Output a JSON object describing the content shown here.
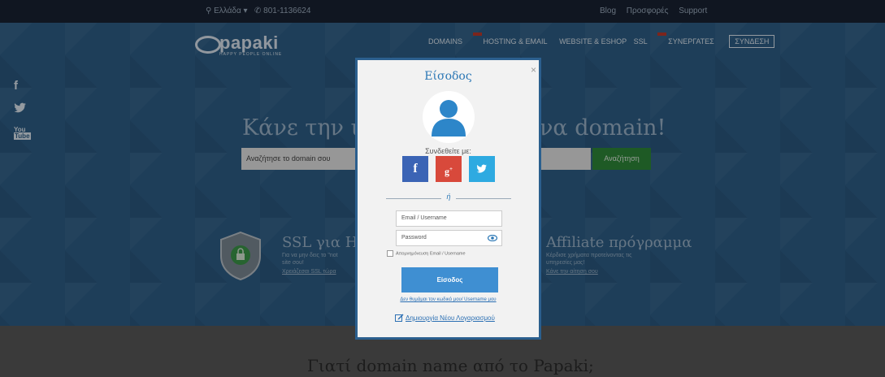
{
  "topbar": {
    "region": "Ελλάδα",
    "phone": "801-1136624",
    "links": [
      "Blog",
      "Προσφορές",
      "Support"
    ]
  },
  "logo": {
    "name": "papaki",
    "tagline": "HAPPY PEOPLE ONLINE"
  },
  "nav": {
    "items": [
      "DOMAINS",
      "HOSTING & EMAIL",
      "WEBSITE & ESHOP",
      "SSL",
      "ΣΥΝΕΡΓΑΤΕΣ"
    ],
    "login": "ΣΥΝΔΕΣΗ"
  },
  "social": [
    "facebook-icon",
    "twitter-icon",
    "youtube-icon"
  ],
  "hero": {
    "title_left": "Κάνε την ιδ",
    "title_right": "να domain!",
    "search_placeholder": "Αναζήτησε το domain σου",
    "search_button": "Αναζήτηση"
  },
  "features": {
    "ssl_title": "SSL για HT",
    "ssl_text": [
      "Για να μην δεις το \"not",
      "site σου!"
    ],
    "ssl_link": "Χρειάζεσαι SSL τώρα",
    "affiliate_title": "Affiliate πρόγραμμα",
    "affiliate_text": [
      "Κέρδισε χρήματα προτείνοντας τις",
      "υπηρεσίες μας!"
    ],
    "affiliate_link": "Κάνε την αίτηση σου"
  },
  "lower_title": "Γιατί domain name από το Papaki;",
  "modal": {
    "title": "Είσοδος",
    "connect_with": "Συνδεθείτε με:",
    "or": "ή",
    "username_placeholder": "Email / Username",
    "password_placeholder": "Password",
    "remember": "Απομνημόνευση Email / Username",
    "login_button": "Είσοδος",
    "forgot": "Δεν θυμάμαι τον κωδικό μου/ Username μου",
    "new_account": "Δημιουργία Νέου Λογαριασμού",
    "close": "×"
  },
  "colors": {
    "hero_bg": "#2e6089",
    "modal_border": "#2b5f8e",
    "primary_button": "#3f8fd2",
    "facebook": "#3b64b5",
    "google_plus": "#d8493b",
    "twitter": "#2eaae1",
    "search_button": "#2f8a3a"
  }
}
